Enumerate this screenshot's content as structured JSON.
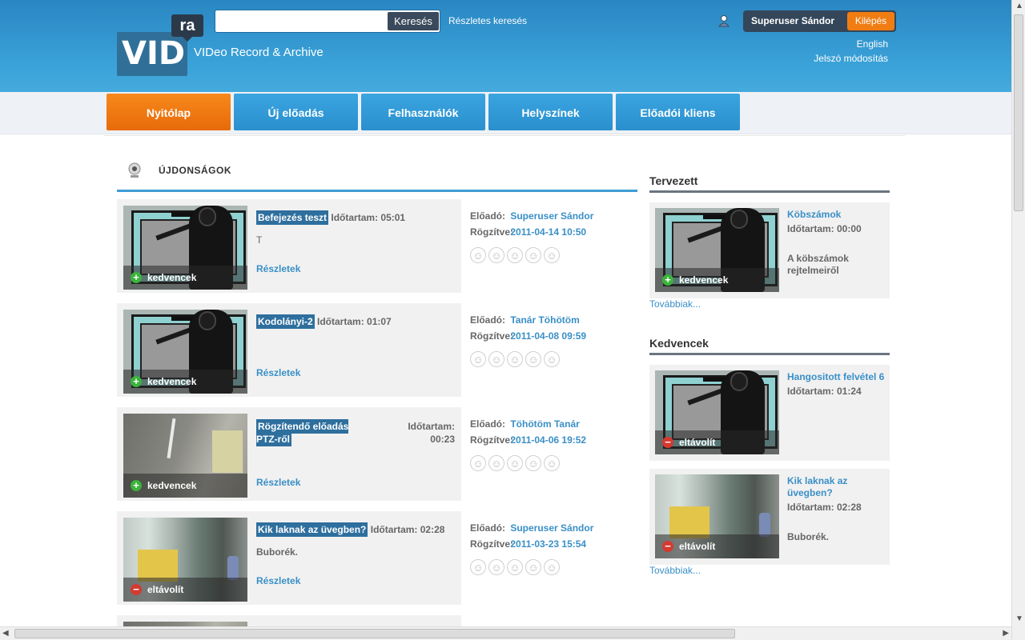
{
  "header": {
    "logo_main": "VID",
    "logo_badge": "ra",
    "tagline": "VIDeo Record & Archive",
    "search_placeholder": "",
    "search_button": "Keresés",
    "advanced_search": "Részletes keresés",
    "user_name": "Superuser Sándor",
    "logout": "Kilépés",
    "language": "English",
    "change_password": "Jelszó módosítás"
  },
  "nav": [
    "Nyitólap",
    "Új előadás",
    "Felhasználók",
    "Helyszínek",
    "Előadói kliens"
  ],
  "news": {
    "title": "ÚJDONSÁGOK",
    "duration_label": "Időtartam:",
    "details": "Részletek",
    "presenter_label": "Előadó:",
    "recorded_label": "Rögzítve:",
    "items": [
      {
        "title": "Befejezés teszt",
        "duration": "05:01",
        "desc": "T",
        "fav": "kedvencek",
        "presenter": "Superuser Sándor",
        "recorded": "2011-04-14 10:50"
      },
      {
        "title": "Kodolányi-2",
        "duration": "01:07",
        "desc": "",
        "fav": "kedvencek",
        "presenter": "Tanár Töhötöm",
        "recorded": "2011-04-08 09:59"
      },
      {
        "title": "Rögzítendő előadás PTZ-ről",
        "duration": "00:23",
        "desc": "",
        "fav": "kedvencek",
        "presenter": "Töhötöm Tanár",
        "recorded": "2011-04-06 19:52"
      },
      {
        "title": "Kik laknak az üvegben?",
        "duration": "02:28",
        "desc": "Buborék.",
        "fav": "eltávolít",
        "presenter": "Superuser Sándor",
        "recorded": "2011-03-23 15:54"
      }
    ]
  },
  "sidebar": {
    "planned_title": "Tervezett",
    "planned": {
      "title": "Köbszámok",
      "duration": "Időtartam: 00:00",
      "desc": "A köbszámok rejtelmeiről",
      "fav": "kedvencek"
    },
    "more": "Továbbiak...",
    "favorites_title": "Kedvencek",
    "favorites": [
      {
        "title": "Hangositott felvétel 6",
        "duration": "Időtartam: 01:24",
        "desc": "",
        "fav": "eltávolít"
      },
      {
        "title": "Kik laknak az üvegben?",
        "duration": "Időtartam: 02:28",
        "desc": "Buborék.",
        "fav": "eltávolít"
      }
    ]
  },
  "icons": {
    "smiley": "smiley-icon",
    "add": "plus-circle-icon",
    "remove": "minus-circle-icon",
    "user": "user-icon",
    "webcam": "webcam-icon"
  },
  "colors": {
    "header_blue": "#3aa2d8",
    "active_nav": "#f07d13",
    "link": "#3a8fc7",
    "title_highlight": "#2e6f9e"
  }
}
